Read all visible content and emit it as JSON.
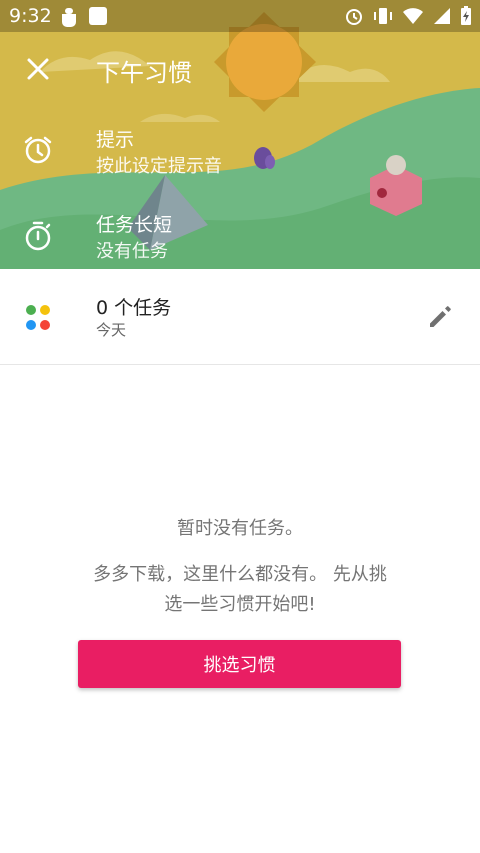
{
  "status_bar": {
    "time": "9:32",
    "icons": [
      "bug-icon",
      "square-icon",
      "alarm-icon",
      "vibrate-icon",
      "wifi-icon",
      "signal-icon",
      "battery-icon"
    ]
  },
  "header": {
    "title": "下午习惯",
    "close_icon": "close-icon"
  },
  "reminder": {
    "icon": "alarm-clock-icon",
    "title": "提示",
    "subtitle": "按此设定提示音"
  },
  "duration": {
    "icon": "timer-icon",
    "title": "任务长短",
    "subtitle": "没有任务"
  },
  "summary": {
    "count_label": "0 个任务",
    "day_label": "今天",
    "dots_icon": "color-dots-icon",
    "edit_icon": "pencil-icon"
  },
  "empty_state": {
    "heading": "暂时没有任务。",
    "message": "多多下载，这里什么都没有。 先从挑选一些习惯开始吧!",
    "button_label": "挑选习惯"
  },
  "colors": {
    "accent": "#e91e63",
    "sky": "#d4b94a",
    "hill": "#6bbf7a",
    "sun": "#e9a93a"
  }
}
